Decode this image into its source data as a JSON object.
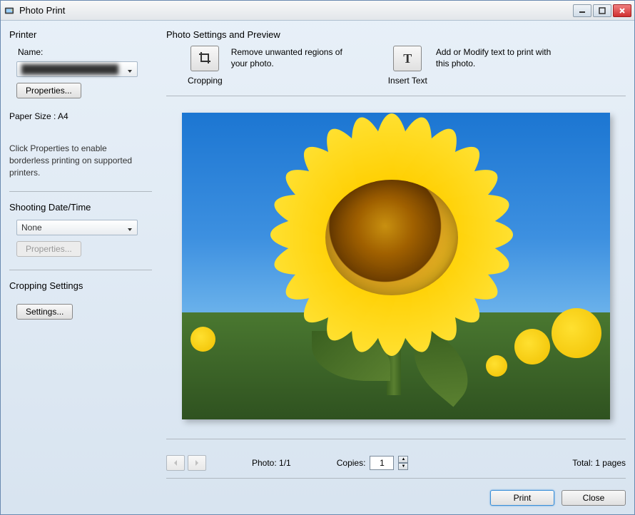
{
  "window": {
    "title": "Photo Print"
  },
  "printer": {
    "section_title": "Printer",
    "name_label": "Name:",
    "selected_name": "████████████████",
    "properties_btn": "Properties...",
    "paper_size_label": "Paper Size :",
    "paper_size_value": "A4",
    "hint": "Click Properties to enable borderless printing on supported printers."
  },
  "shooting": {
    "section_title": "Shooting Date/Time",
    "selected": "None",
    "properties_btn": "Properties..."
  },
  "cropping_settings": {
    "section_title": "Cropping Settings",
    "settings_btn": "Settings..."
  },
  "preview": {
    "header": "Photo Settings and Preview",
    "cropping_label": "Cropping",
    "cropping_desc": "Remove unwanted regions of your photo.",
    "insert_text_label": "Insert Text",
    "insert_text_desc": "Add or Modify text to print with this photo."
  },
  "nav": {
    "photo_label": "Photo:",
    "photo_value": "1/1",
    "copies_label": "Copies:",
    "copies_value": "1",
    "total_label": "Total:",
    "total_value": "1 pages"
  },
  "footer": {
    "print_btn": "Print",
    "close_btn": "Close"
  }
}
